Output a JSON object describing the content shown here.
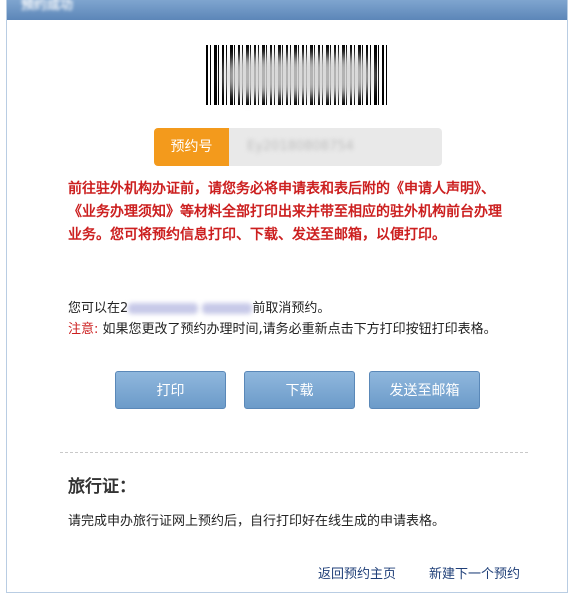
{
  "window": {
    "title": "预约成功"
  },
  "appointment": {
    "label": "预约号",
    "value": "Ey20180808754"
  },
  "notice": "前往驻外机构办证前，请您务必将申请表和表后附的《申请人声明》、《业务办理须知》等材料全部打印出来并带至相应的驻外机构前台办理业务。您可将预约信息打印、下载、发送至邮箱，以便打印。",
  "info": {
    "cancel_prefix": "您可以在2",
    "cancel_suffix": "前取消预约。",
    "note_label": "注意:",
    "note_text": "如果您更改了预约办理时间,请务必重新点击下方打印按钮打印表格。"
  },
  "buttons": {
    "print": "打印",
    "download": "下载",
    "email": "发送至邮箱"
  },
  "section": {
    "title": "旅行证：",
    "desc": "请完成申办旅行证网上预约后，自行打印好在线生成的申请表格。"
  },
  "footer": {
    "back": "返回预约主页",
    "new": "新建下一个预约"
  }
}
